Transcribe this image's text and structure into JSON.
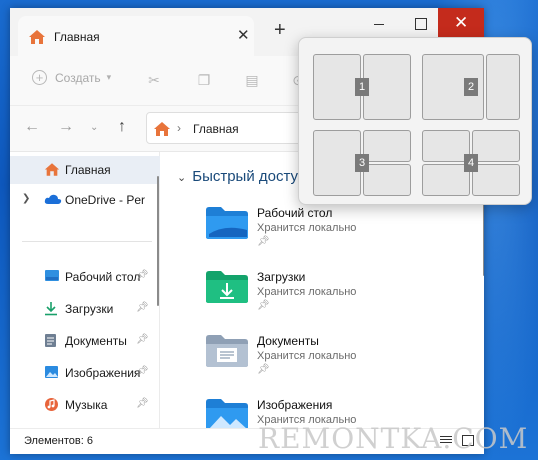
{
  "tab": {
    "title": "Главная"
  },
  "window_controls": {
    "close": "✕"
  },
  "command_bar": {
    "new_label": "Создать"
  },
  "address": {
    "location": "Главная"
  },
  "sidebar": {
    "items": [
      {
        "label": "Главная"
      },
      {
        "label": "OneDrive - Personal"
      },
      {
        "label": "Рабочий стол"
      },
      {
        "label": "Загрузки"
      },
      {
        "label": "Документы"
      },
      {
        "label": "Изображения"
      },
      {
        "label": "Музыка"
      }
    ]
  },
  "main": {
    "section_title": "Быстрый доступ",
    "items": [
      {
        "name": "Рабочий стол",
        "subtitle": "Хранится локально"
      },
      {
        "name": "Загрузки",
        "subtitle": "Хранится локально"
      },
      {
        "name": "Документы",
        "subtitle": "Хранится локально"
      },
      {
        "name": "Изображения",
        "subtitle": "Хранится локально"
      }
    ]
  },
  "status": {
    "count": "Элементов: 6"
  },
  "snap": {
    "numbers": [
      "1",
      "2",
      "3",
      "4"
    ]
  },
  "watermark": "REMONTKA.COM",
  "colors": {
    "close_button": "#c42b1c",
    "accent": "#0e58bd",
    "home_icon": "#e8743b"
  },
  "icons": [
    "home-icon",
    "onedrive-icon",
    "desktop-icon",
    "download-icon",
    "documents-icon",
    "pictures-icon",
    "music-icon",
    "pin-icon"
  ]
}
